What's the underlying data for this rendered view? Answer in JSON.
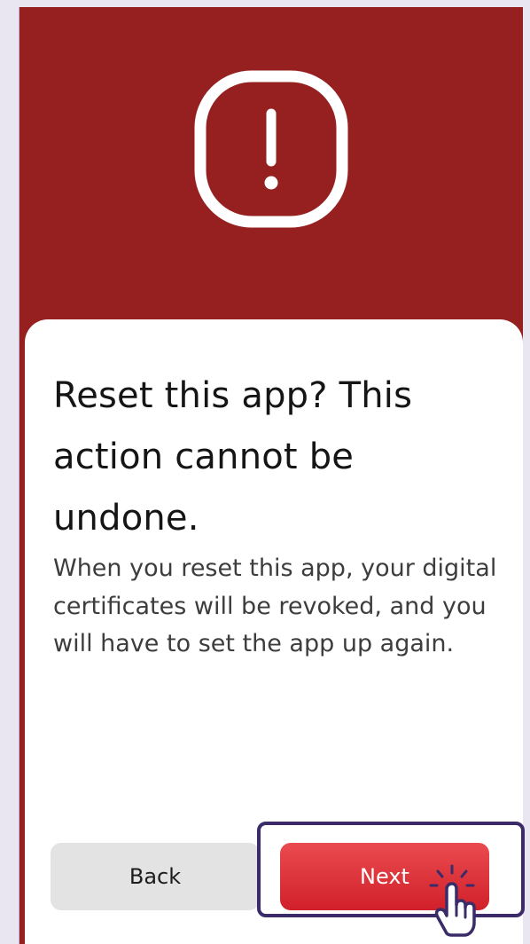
{
  "dialog": {
    "title": "Reset this app? This action cannot be undone.",
    "body": "When you reset this app, your digital certificates will be revoked, and you will have to set the app up again."
  },
  "buttons": {
    "back_label": "Back",
    "next_label": "Next"
  },
  "icons": {
    "hero": "alert-exclamation-icon",
    "cursor": "hand-pointer-cursor-icon"
  },
  "colors": {
    "header_background": "#96201f",
    "next_button": "#e0353b",
    "back_button": "#e3e3e3",
    "highlight_outline": "#3b2c69",
    "page_background": "#e9e5f1"
  }
}
